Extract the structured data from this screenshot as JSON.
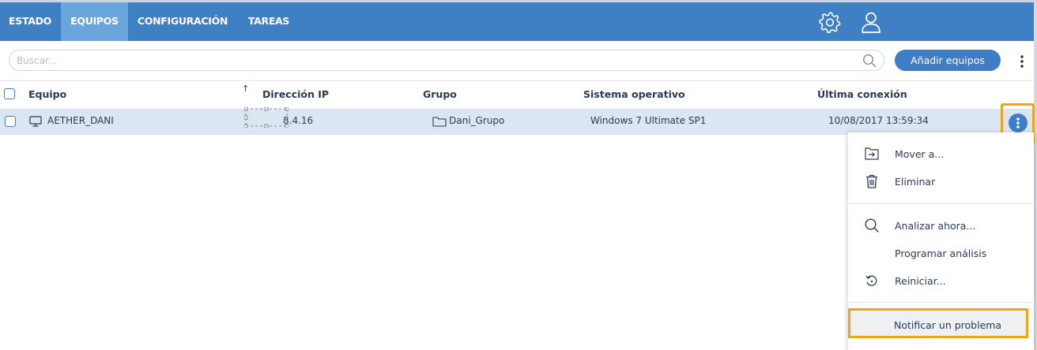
{
  "nav": {
    "tabs": [
      {
        "label": "ESTADO"
      },
      {
        "label": "EQUIPOS",
        "active": true
      },
      {
        "label": "CONFIGURACIÓN"
      },
      {
        "label": "TAREAS"
      }
    ],
    "settings_icon": "gear-icon",
    "user_icon": "user-icon"
  },
  "toolbar": {
    "search_placeholder": "Buscar...",
    "search_value": "",
    "add_button_label": "Añadir equipos"
  },
  "table": {
    "columns": [
      "Equipo",
      "Dirección IP",
      "Grupo",
      "Sistema operativo",
      "Última conexión"
    ],
    "sort_indicator": "↑",
    "rows": [
      {
        "equipo": "AETHER_DANI",
        "ip": "8.4.16",
        "grupo": "Dani_Grupo",
        "so": "Windows 7 Ultimate SP1",
        "ultima_conexion": "10/08/2017 13:59:34"
      }
    ]
  },
  "context_menu": {
    "items": [
      {
        "label": "Mover a...",
        "icon": "move-to-icon"
      },
      {
        "label": "Eliminar",
        "icon": "trash-icon"
      },
      {
        "label": "Analizar ahora...",
        "icon": "search-icon"
      },
      {
        "label": "Programar análisis",
        "icon": ""
      },
      {
        "label": "Reiniciar...",
        "icon": "restart-icon"
      },
      {
        "label": "Notificar un problema",
        "icon": ""
      }
    ]
  },
  "colors": {
    "primary": "#3f7fc4",
    "active_tab": "#6aa6db",
    "row_selected": "#dbe6f2",
    "highlight": "#f0a419"
  }
}
